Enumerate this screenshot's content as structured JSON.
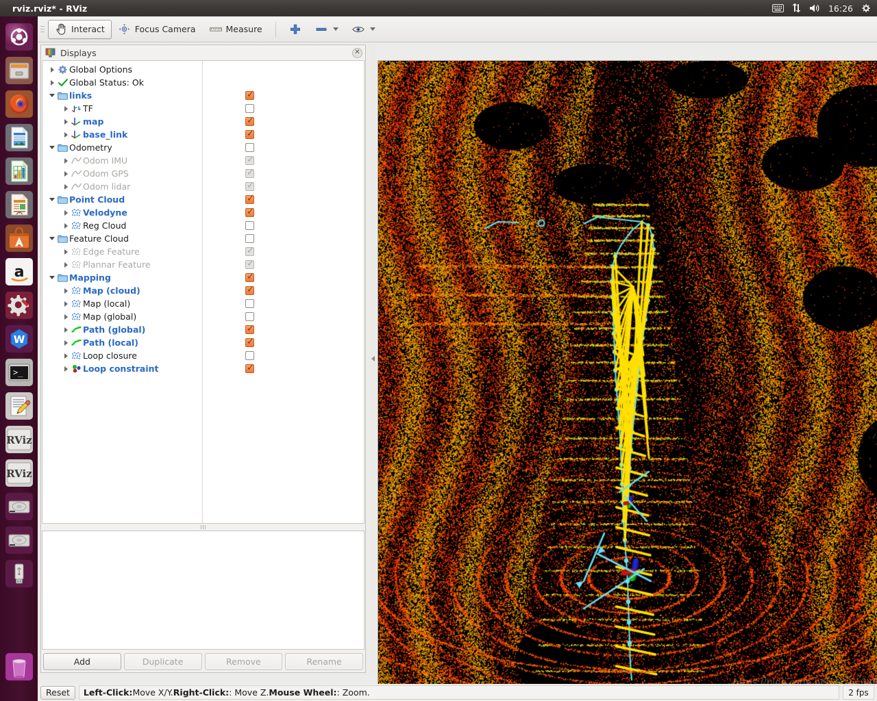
{
  "window": {
    "title": "rviz.rviz* - RViz"
  },
  "tray": {
    "clock": "16:26",
    "icons": [
      "keyboard-icon",
      "network-icon",
      "volume-icon",
      "gear-icon"
    ]
  },
  "launcher": {
    "items": [
      {
        "name": "ubuntu-dash-icon",
        "label": "Dash home"
      },
      {
        "name": "files-icon",
        "label": "Files"
      },
      {
        "name": "firefox-icon",
        "label": "Firefox"
      },
      {
        "name": "libreoffice-writer-icon",
        "label": "LibreOffice Writer"
      },
      {
        "name": "libreoffice-calc-icon",
        "label": "LibreOffice Calc"
      },
      {
        "name": "libreoffice-impress-icon",
        "label": "LibreOffice Impress"
      },
      {
        "name": "ubuntu-software-icon",
        "label": "Ubuntu Software"
      },
      {
        "name": "amazon-icon",
        "label": "Amazon"
      },
      {
        "name": "system-settings-icon",
        "label": "System Settings"
      },
      {
        "name": "wps-office-icon",
        "label": "WPS Office"
      },
      {
        "name": "terminal-icon",
        "label": "Terminal"
      },
      {
        "name": "text-editor-icon",
        "label": "Text Editor"
      },
      {
        "name": "rviz-icon",
        "label": "RViz"
      },
      {
        "name": "rviz-icon",
        "label": "RViz"
      },
      {
        "name": "disk-drive-icon",
        "label": "Disk"
      },
      {
        "name": "disk-drive-icon",
        "label": "Disk"
      },
      {
        "name": "usb-drive-icon",
        "label": "USB Drive"
      },
      {
        "name": "trash-icon",
        "label": "Trash"
      }
    ]
  },
  "toolbar": {
    "interact_label": "Interact",
    "focus_camera_label": "Focus Camera",
    "measure_label": "Measure",
    "plus_label": "+",
    "minus_label": "−"
  },
  "displays_panel": {
    "title": "Displays",
    "close_label": "✕",
    "tree": [
      {
        "label": "Global Options",
        "depth": 0,
        "icon": "gear-icon",
        "arrow": "closed",
        "check": "none",
        "bold": false,
        "dim": false
      },
      {
        "label": "Global Status: Ok",
        "depth": 0,
        "icon": "check-icon",
        "arrow": "closed",
        "check": "none",
        "bold": false,
        "dim": false
      },
      {
        "label": "links",
        "depth": 0,
        "icon": "folder-icon",
        "arrow": "open",
        "check": "on",
        "bold": true,
        "dim": false
      },
      {
        "label": "TF",
        "depth": 1,
        "icon": "tf-icon",
        "arrow": "closed",
        "check": "off",
        "bold": false,
        "dim": false
      },
      {
        "label": "map",
        "depth": 1,
        "icon": "axes-icon",
        "arrow": "closed",
        "check": "on",
        "bold": true,
        "dim": false
      },
      {
        "label": "base_link",
        "depth": 1,
        "icon": "axes-icon",
        "arrow": "closed",
        "check": "on",
        "bold": true,
        "dim": false
      },
      {
        "label": "Odometry",
        "depth": 0,
        "icon": "folder-icon",
        "arrow": "open",
        "check": "off",
        "bold": false,
        "dim": false
      },
      {
        "label": "Odom IMU",
        "depth": 1,
        "icon": "odom-icon",
        "arrow": "closed",
        "check": "disabled",
        "bold": false,
        "dim": true
      },
      {
        "label": "Odom GPS",
        "depth": 1,
        "icon": "odom-icon",
        "arrow": "closed",
        "check": "disabled",
        "bold": false,
        "dim": true
      },
      {
        "label": "Odom lidar",
        "depth": 1,
        "icon": "odom-icon",
        "arrow": "closed",
        "check": "disabled",
        "bold": false,
        "dim": true
      },
      {
        "label": "Point Cloud",
        "depth": 0,
        "icon": "folder-icon",
        "arrow": "open",
        "check": "on",
        "bold": true,
        "dim": false
      },
      {
        "label": "Velodyne",
        "depth": 1,
        "icon": "pointcloud-icon",
        "arrow": "closed",
        "check": "on",
        "bold": true,
        "dim": false
      },
      {
        "label": "Reg Cloud",
        "depth": 1,
        "icon": "pointcloud-icon",
        "arrow": "closed",
        "check": "off",
        "bold": false,
        "dim": false
      },
      {
        "label": "Feature Cloud",
        "depth": 0,
        "icon": "folder-icon",
        "arrow": "open",
        "check": "off",
        "bold": false,
        "dim": false
      },
      {
        "label": "Edge Feature",
        "depth": 1,
        "icon": "pointcloud-icon",
        "arrow": "closed",
        "check": "disabled",
        "bold": false,
        "dim": true
      },
      {
        "label": "Plannar Feature",
        "depth": 1,
        "icon": "pointcloud-icon",
        "arrow": "closed",
        "check": "disabled",
        "bold": false,
        "dim": true
      },
      {
        "label": "Mapping",
        "depth": 0,
        "icon": "folder-icon",
        "arrow": "open",
        "check": "on",
        "bold": true,
        "dim": false
      },
      {
        "label": "Map (cloud)",
        "depth": 1,
        "icon": "pointcloud-icon",
        "arrow": "closed",
        "check": "on",
        "bold": true,
        "dim": false
      },
      {
        "label": "Map (local)",
        "depth": 1,
        "icon": "pointcloud-icon",
        "arrow": "closed",
        "check": "off",
        "bold": false,
        "dim": false
      },
      {
        "label": "Map (global)",
        "depth": 1,
        "icon": "pointcloud-icon",
        "arrow": "closed",
        "check": "off",
        "bold": false,
        "dim": false
      },
      {
        "label": "Path (global)",
        "depth": 1,
        "icon": "path-icon",
        "arrow": "closed",
        "check": "on",
        "bold": true,
        "dim": false
      },
      {
        "label": "Path (local)",
        "depth": 1,
        "icon": "path-icon",
        "arrow": "closed",
        "check": "on",
        "bold": true,
        "dim": false
      },
      {
        "label": "Loop closure",
        "depth": 1,
        "icon": "pointcloud-icon",
        "arrow": "closed",
        "check": "off",
        "bold": false,
        "dim": false
      },
      {
        "label": "Loop constraint",
        "depth": 1,
        "icon": "markers-icon",
        "arrow": "closed",
        "check": "on",
        "bold": true,
        "dim": false
      }
    ],
    "buttons": [
      {
        "label": "Add",
        "enabled": true
      },
      {
        "label": "Duplicate",
        "enabled": false
      },
      {
        "label": "Remove",
        "enabled": false
      },
      {
        "label": "Rename",
        "enabled": false
      }
    ]
  },
  "viewport": {
    "watermark": "https://blog.csdn.net/cyx61048",
    "colors": {
      "pointcloud_hot": "#ff3000",
      "pointcloud_mid": "#ff7a00",
      "pointcloud_low": "#b0ff20",
      "path": "#66e0f5",
      "loop_constraint": "#ffe000",
      "axis_x": "#e01010",
      "axis_y": "#10c010",
      "axis_z": "#1020e0",
      "background": "#000000"
    }
  },
  "statusbar": {
    "reset_label": "Reset",
    "hint_parts": [
      {
        "text": "Left-Click:",
        "bold": true
      },
      {
        "text": " Move X/Y. ",
        "bold": false
      },
      {
        "text": "Right-Click:",
        "bold": true
      },
      {
        "text": ": Move Z. ",
        "bold": false
      },
      {
        "text": "Mouse Wheel:",
        "bold": true
      },
      {
        "text": ": Zoom.",
        "bold": false
      }
    ],
    "fps": "2 fps"
  }
}
